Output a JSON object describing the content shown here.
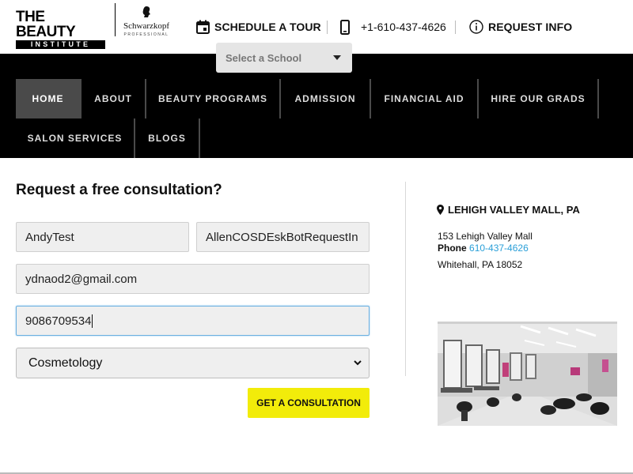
{
  "brand": {
    "logo_line1": "THE BEAUTY",
    "logo_line2": "INSTITUTE",
    "partner_name": "Schwarzkopf",
    "partner_sub": "PROFESSIONAL"
  },
  "header": {
    "schedule_label": "SCHEDULE A TOUR",
    "phone_label": "+1-610-437-4626",
    "request_info_label": "REQUEST INFO"
  },
  "school_select": {
    "placeholder": "Select a School"
  },
  "nav": {
    "items": [
      {
        "label": "HOME",
        "active": true
      },
      {
        "label": "ABOUT",
        "active": false
      },
      {
        "label": "BEAUTY PROGRAMS",
        "active": false
      },
      {
        "label": "ADMISSION",
        "active": false
      },
      {
        "label": "FINANCIAL AID",
        "active": false
      },
      {
        "label": "HIRE OUR GRADS",
        "active": false
      },
      {
        "label": "SALON SERVICES",
        "active": false
      },
      {
        "label": "BLOGS",
        "active": false
      }
    ]
  },
  "form": {
    "title": "Request a free consultation?",
    "first_name_value": "AndyTest",
    "last_name_value": "AllenCOSDEskBotRequestIn",
    "email_value": "ydnaod2@gmail.com",
    "phone_value": "9086709534",
    "program_selected": "Cosmetology",
    "submit_label": "GET A CONSULTATION"
  },
  "location": {
    "title": "LEHIGH VALLEY MALL, PA",
    "address_line1": "153 Lehigh Valley Mall",
    "phone_prefix": "Phone",
    "phone": "610-437-4626",
    "address_line2": "Whitehall, PA 18052"
  },
  "colors": {
    "accent_yellow": "#f2ec0a",
    "nav_bg": "#000000",
    "nav_active": "#4a4a4a",
    "link_blue": "#2a9fd8"
  }
}
